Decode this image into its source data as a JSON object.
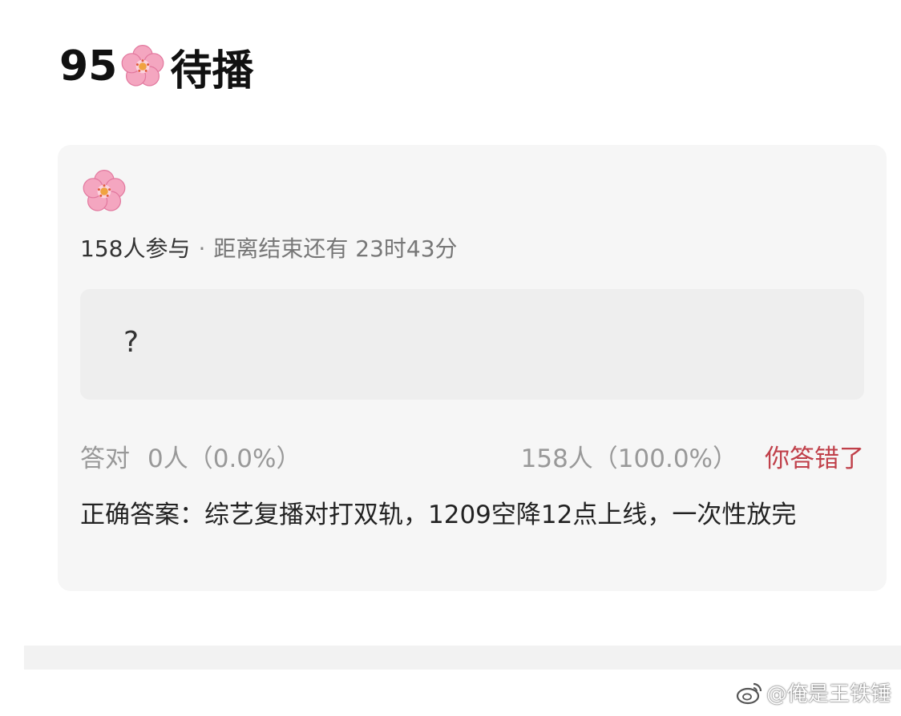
{
  "post": {
    "title_prefix": "95",
    "title_emoji": "cherry-blossom-icon",
    "title_suffix": "待播"
  },
  "quiz": {
    "emoji": "cherry-blossom-icon",
    "participants": "158人参与",
    "separator": "·",
    "countdown": "距离结束还有 23时43分",
    "question": "?",
    "correct_label": "答对",
    "correct_count": "0人（0.0%）",
    "wrong_count": "158人（100.0%）",
    "status": "你答错了",
    "answer": "正确答案：综艺复播对打双轨，1209空降12点上线，一次性放完"
  },
  "watermark": {
    "logo": "weibo-logo-icon",
    "text": "@俺是王铁锤"
  },
  "colors": {
    "card_bg": "#f6f6f6",
    "question_bg": "#eeeeee",
    "wrong_status": "#c0404a",
    "muted_text": "#999999"
  }
}
